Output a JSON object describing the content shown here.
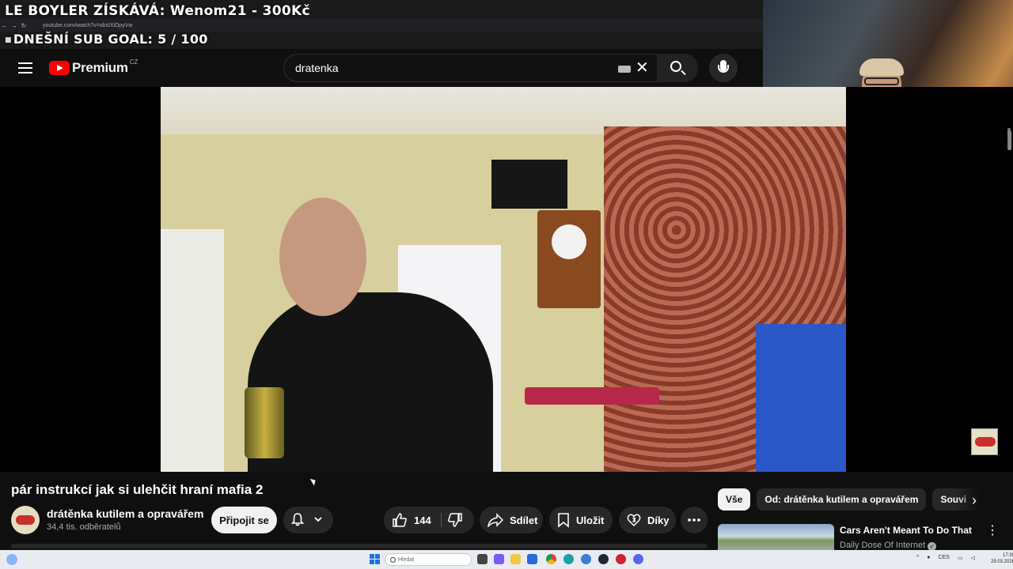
{
  "overlay": {
    "top_text": "LE BOYLER ZÍSKÁVÁ: Wenom21 - 300Kč",
    "goal_text": "DNEŠNÍ SUB GOAL: 5 / 100",
    "goal_bullet": "■"
  },
  "browser": {
    "url": "youtube.com/watch?v=obsIXiDpyVw"
  },
  "header": {
    "logo_text": "Premium",
    "region": "CZ",
    "search_value": "dratenka"
  },
  "video": {
    "title": "pár instrukcí jak si ulehčit hraní mafia 2"
  },
  "channel": {
    "name": "drátěnka kutilem a opravářem",
    "subscribers": "34,4 tis. odběratelů",
    "join_label": "Připojit se"
  },
  "actions": {
    "likes": "144",
    "share_label": "Sdílet",
    "save_label": "Uložit",
    "thanks_label": "Díky"
  },
  "chips": [
    {
      "label": "Vše",
      "active": true
    },
    {
      "label": "Od: drátěnka kutilem a opravářem",
      "active": false
    },
    {
      "label": "Souvi",
      "active": false
    }
  ],
  "recommendation": {
    "title": "Cars Aren't Meant To Do That",
    "channel": "Daily Dose Of Internet"
  },
  "taskbar": {
    "search_placeholder": "Hledat",
    "lang": "CES",
    "time": "17:39",
    "date": "29.03.2026"
  },
  "colors": {
    "yt_red": "#ff0000",
    "background": "#0f0f0f",
    "pill": "#272727"
  }
}
